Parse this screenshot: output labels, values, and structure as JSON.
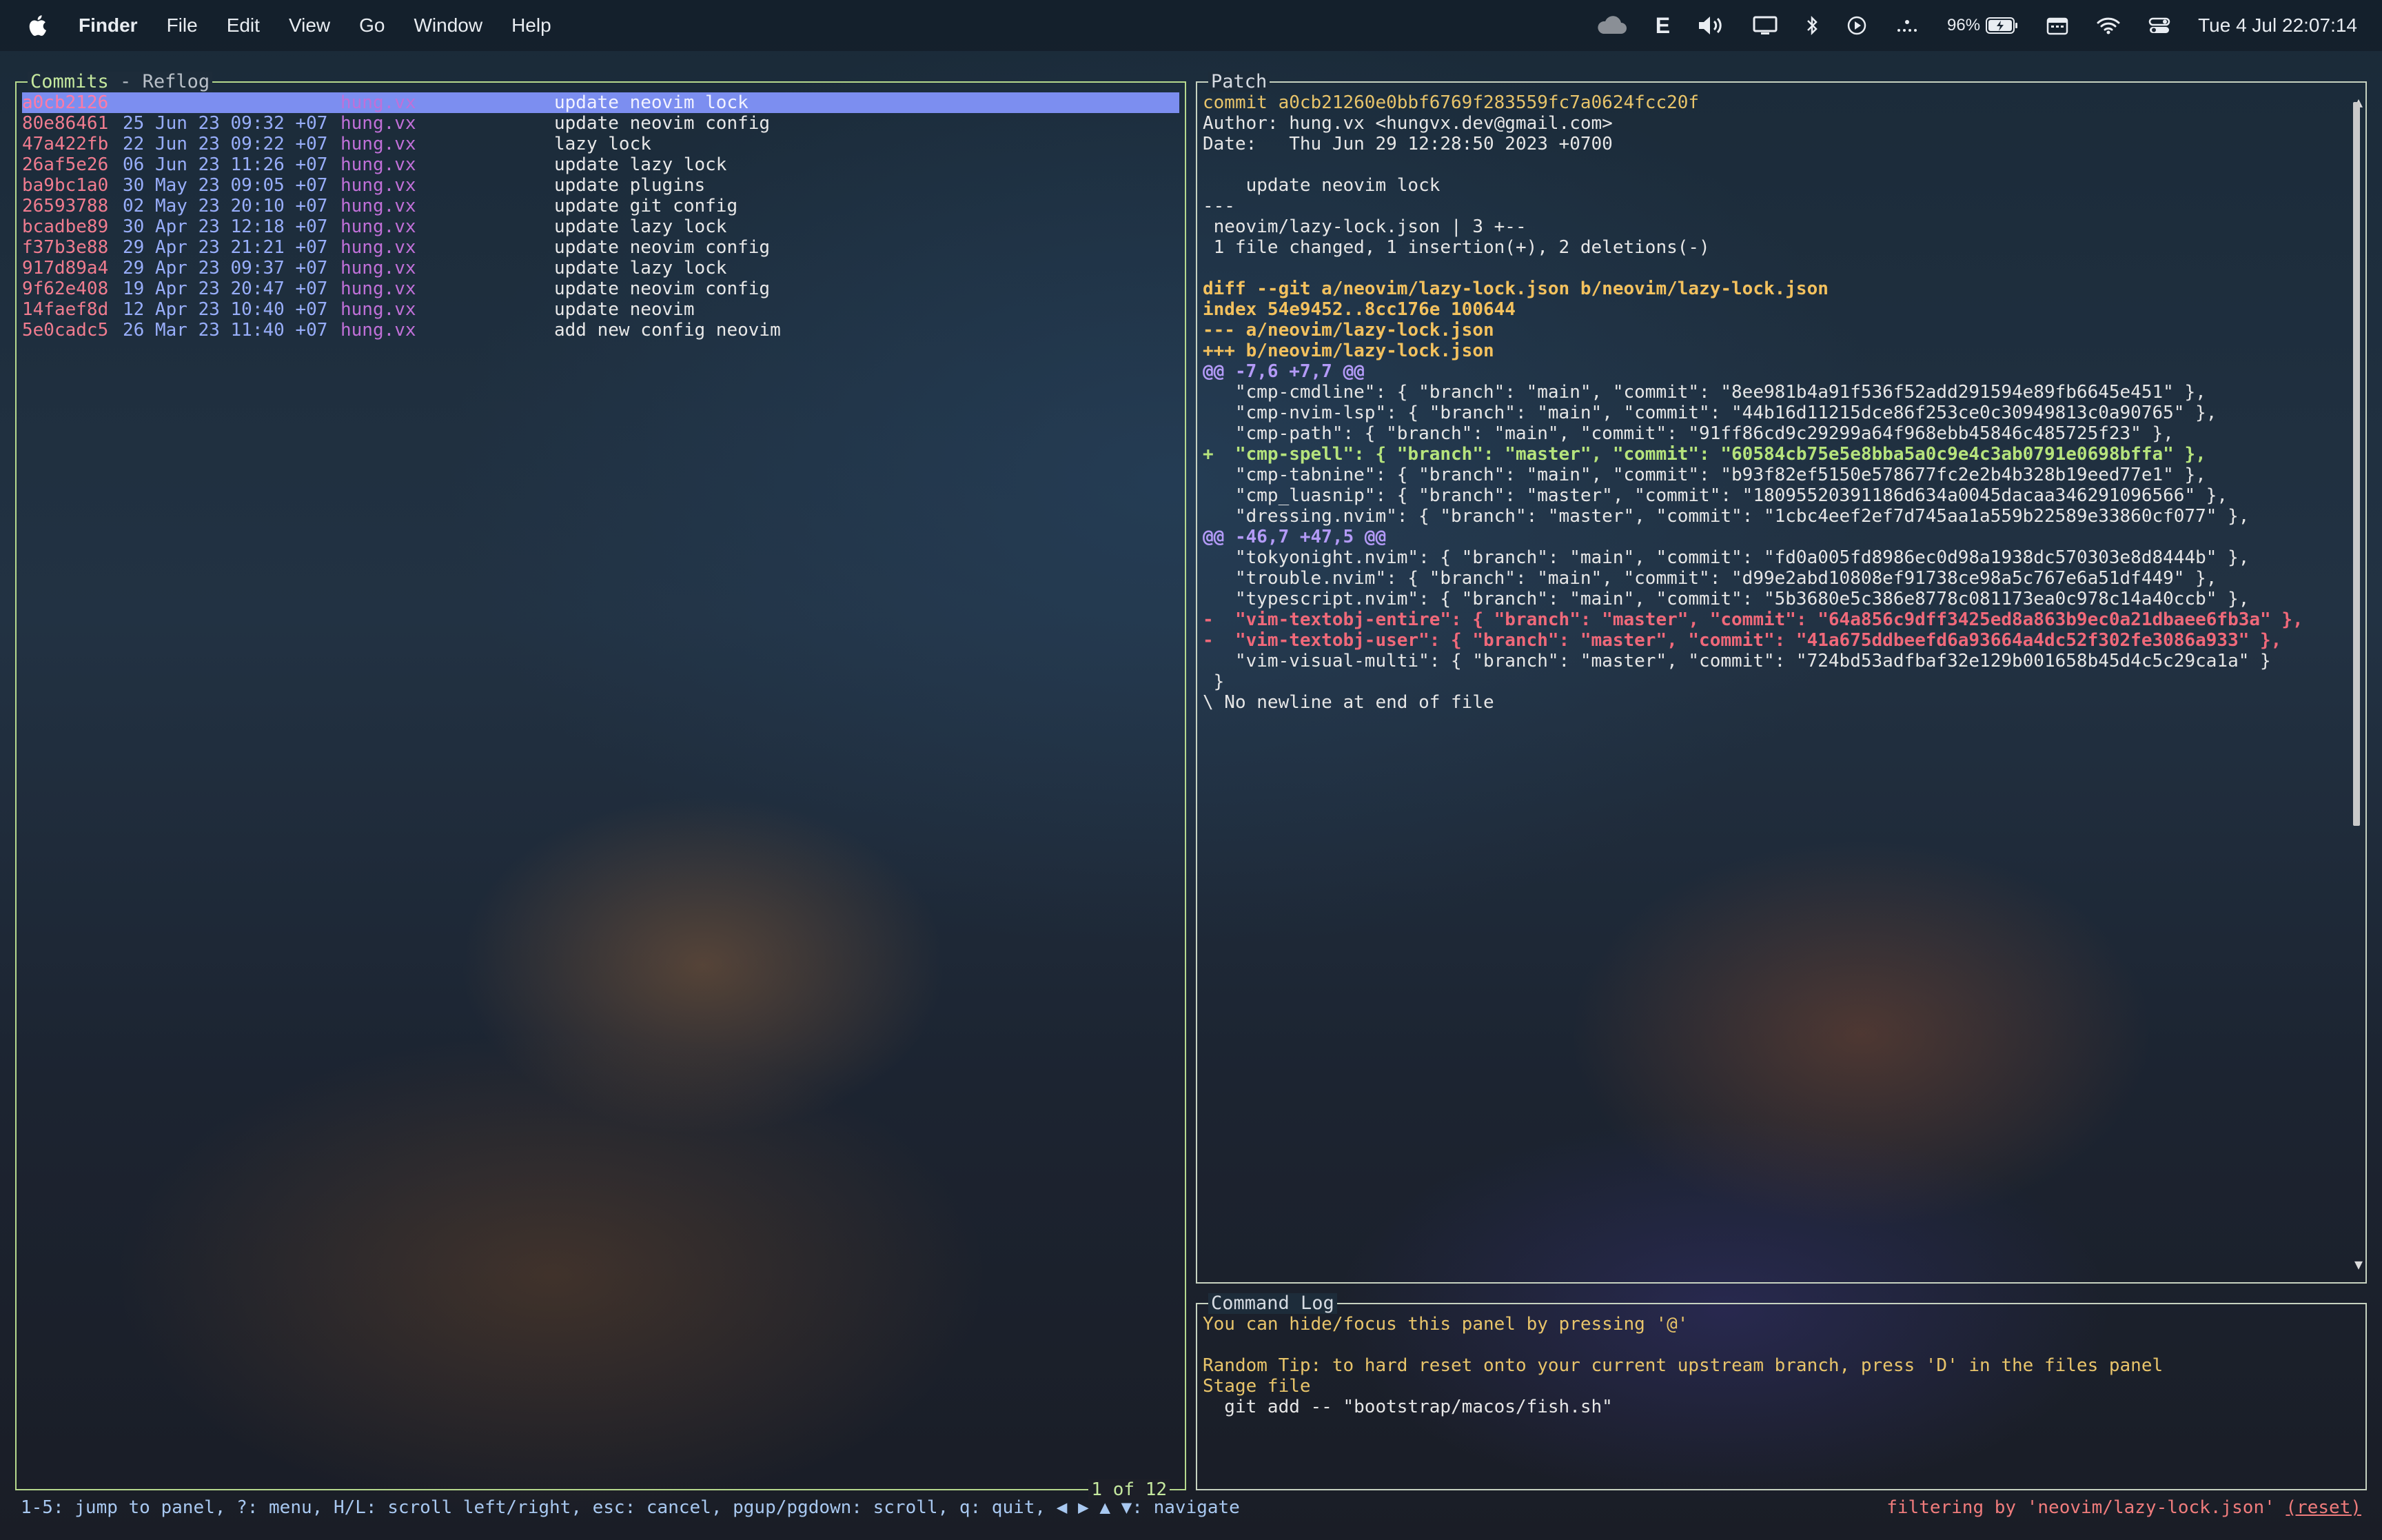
{
  "menubar": {
    "app": "Finder",
    "items": [
      "File",
      "Edit",
      "View",
      "Go",
      "Window",
      "Help"
    ],
    "status_icons": [
      "cloud-icon",
      "keyboard-e-icon",
      "volume-icon",
      "display-icon",
      "bluetooth-icon",
      "play-icon",
      "wifi-icon",
      "control-center-icon"
    ],
    "keyboard_letter": "E",
    "battery": "96%",
    "clock": "Tue 4 Jul  22:07:14"
  },
  "commits": {
    "title_active": "Commits",
    "title_sep": " - ",
    "title_other": "Reflog",
    "rows": [
      {
        "hash": "a0cb2126",
        "date": "",
        "author": "hung.vx",
        "message": "update neovim lock"
      },
      {
        "hash": "80e86461",
        "date": "25 Jun 23 09:32 +07",
        "author": "hung.vx",
        "message": "update neovim config"
      },
      {
        "hash": "47a422fb",
        "date": "22 Jun 23 09:22 +07",
        "author": "hung.vx",
        "message": "lazy lock"
      },
      {
        "hash": "26af5e26",
        "date": "06 Jun 23 11:26 +07",
        "author": "hung.vx",
        "message": "update lazy lock"
      },
      {
        "hash": "ba9bc1a0",
        "date": "30 May 23 09:05 +07",
        "author": "hung.vx",
        "message": "update plugins"
      },
      {
        "hash": "26593788",
        "date": "02 May 23 20:10 +07",
        "author": "hung.vx",
        "message": "update git config"
      },
      {
        "hash": "bcadbe89",
        "date": "30 Apr 23 12:18 +07",
        "author": "hung.vx",
        "message": "update lazy lock"
      },
      {
        "hash": "f37b3e88",
        "date": "29 Apr 23 21:21 +07",
        "author": "hung.vx",
        "message": "update neovim config"
      },
      {
        "hash": "917d89a4",
        "date": "29 Apr 23 09:37 +07",
        "author": "hung.vx",
        "message": "update lazy lock"
      },
      {
        "hash": "9f62e408",
        "date": "19 Apr 23 20:47 +07",
        "author": "hung.vx",
        "message": "update neovim config"
      },
      {
        "hash": "14faef8d",
        "date": "12 Apr 23 10:40 +07",
        "author": "hung.vx",
        "message": "update neovim"
      },
      {
        "hash": "5e0cadc5",
        "date": "26 Mar 23 11:40 +07",
        "author": "hung.vx",
        "message": "add new config neovim"
      }
    ],
    "count_label": "1 of 12"
  },
  "patch": {
    "title": "Patch",
    "lines": [
      {
        "t": "commit a0cb21260e0bbf6769f283559fc7a0624fcc20f",
        "c": "y"
      },
      {
        "t": "Author: hung.vx <hungvx.dev@gmail.com>",
        "c": "w"
      },
      {
        "t": "Date:   Thu Jun 29 12:28:50 2023 +0700",
        "c": "w"
      },
      {
        "t": "",
        "c": "w"
      },
      {
        "t": "    update neovim lock",
        "c": "w"
      },
      {
        "t": "---",
        "c": "w"
      },
      {
        "t": " neovim/lazy-lock.json | 3 +--",
        "c": "w"
      },
      {
        "t": " 1 file changed, 1 insertion(+), 2 deletions(-)",
        "c": "w"
      },
      {
        "t": "",
        "c": "w"
      },
      {
        "t": "diff --git a/neovim/lazy-lock.json b/neovim/lazy-lock.json",
        "c": "dy"
      },
      {
        "t": "index 54e9452..8cc176e 100644",
        "c": "dy"
      },
      {
        "t": "--- a/neovim/lazy-lock.json",
        "c": "dy"
      },
      {
        "t": "+++ b/neovim/lazy-lock.json",
        "c": "dy"
      },
      {
        "t": "@@ -7,6 +7,7 @@",
        "c": "hk"
      },
      {
        "t": "   \"cmp-cmdline\": { \"branch\": \"main\", \"commit\": \"8ee981b4a91f536f52add291594e89fb6645e451\" },",
        "c": "w"
      },
      {
        "t": "   \"cmp-nvim-lsp\": { \"branch\": \"main\", \"commit\": \"44b16d11215dce86f253ce0c30949813c0a90765\" },",
        "c": "w"
      },
      {
        "t": "   \"cmp-path\": { \"branch\": \"main\", \"commit\": \"91ff86cd9c29299a64f968ebb45846c485725f23\" },",
        "c": "w"
      },
      {
        "t": "+  \"cmp-spell\": { \"branch\": \"master\", \"commit\": \"60584cb75e5e8bba5a0c9e4c3ab0791e0698bffa\" },",
        "c": "ad"
      },
      {
        "t": "   \"cmp-tabnine\": { \"branch\": \"main\", \"commit\": \"b93f82ef5150e578677fc2e2b4b328b19eed77e1\" },",
        "c": "w"
      },
      {
        "t": "   \"cmp_luasnip\": { \"branch\": \"master\", \"commit\": \"18095520391186d634a0045dacaa346291096566\" },",
        "c": "w"
      },
      {
        "t": "   \"dressing.nvim\": { \"branch\": \"master\", \"commit\": \"1cbc4eef2ef7d745aa1a559b22589e33860cf077\" },",
        "c": "w"
      },
      {
        "t": "@@ -46,7 +47,5 @@",
        "c": "hk"
      },
      {
        "t": "   \"tokyonight.nvim\": { \"branch\": \"main\", \"commit\": \"fd0a005fd8986ec0d98a1938dc570303e8d8444b\" },",
        "c": "w"
      },
      {
        "t": "   \"trouble.nvim\": { \"branch\": \"main\", \"commit\": \"d99e2abd10808ef91738ce98a5c767e6a51df449\" },",
        "c": "w"
      },
      {
        "t": "   \"typescript.nvim\": { \"branch\": \"main\", \"commit\": \"5b3680e5c386e8778c081173ea0c978c14a40ccb\" },",
        "c": "w"
      },
      {
        "t": "-  \"vim-textobj-entire\": { \"branch\": \"master\", \"commit\": \"64a856c9dff3425ed8a863b9ec0a21dbaee6fb3a\" },",
        "c": "rm"
      },
      {
        "t": "-  \"vim-textobj-user\": { \"branch\": \"master\", \"commit\": \"41a675ddbeefd6a93664a4dc52f302fe3086a933\" },",
        "c": "rm"
      },
      {
        "t": "   \"vim-visual-multi\": { \"branch\": \"master\", \"commit\": \"724bd53adfbaf32e129b001658b45d4c5c29ca1a\" }",
        "c": "w"
      },
      {
        "t": " }",
        "c": "w"
      },
      {
        "t": "\\ No newline at end of file",
        "c": "w"
      }
    ]
  },
  "command_log": {
    "title": "Command Log",
    "lines": [
      {
        "t": "You can hide/focus this panel by pressing '@'",
        "c": "y"
      },
      {
        "t": "",
        "c": "w"
      },
      {
        "t": "Random Tip: to hard reset onto your current upstream branch, press 'D' in the files panel",
        "c": "y"
      },
      {
        "t": "Stage file",
        "c": "y"
      },
      {
        "t": "  git add -- \"bootstrap/macos/fish.sh\"",
        "c": "w"
      }
    ]
  },
  "statusbar": {
    "keys": "1-5: jump to panel, ?: menu, H/L: scroll left/right, esc: cancel, pgup/pgdown: scroll, q: quit, ",
    "arrows": "◀ ▶ ▲ ▼",
    "nav": ": navigate",
    "filter_prefix": "filtering by 'neovim/lazy-lock.json' ",
    "reset": "(reset)"
  }
}
